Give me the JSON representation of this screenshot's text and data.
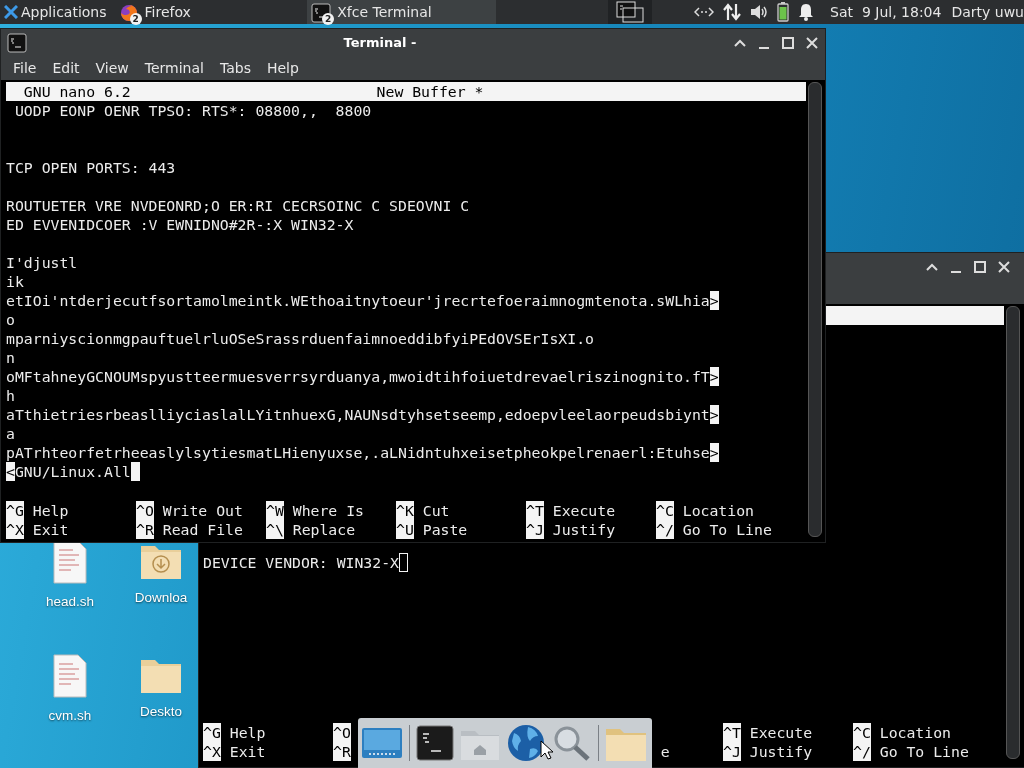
{
  "top_panel": {
    "menu_label": "Applications",
    "tasks": [
      {
        "label": "Firefox",
        "badge": "2",
        "kind": "browser",
        "selected": false
      },
      {
        "label": "Xfce Terminal",
        "badge": "2",
        "kind": "terminal",
        "selected": true
      }
    ],
    "clock": "Sat  9 Jul, 18:04",
    "user": "Darty uwu"
  },
  "desktop_icons": [
    {
      "label": "head.sh",
      "kind": "file"
    },
    {
      "label": "Downloa",
      "kind": "downloads"
    },
    {
      "label": "cvm.sh",
      "kind": "file"
    },
    {
      "label": "Deskto",
      "kind": "folder"
    }
  ],
  "main_window": {
    "title": "Terminal -",
    "menu": [
      "File",
      "Edit",
      "View",
      "Terminal",
      "Tabs",
      "Help"
    ],
    "nano": {
      "header_left": "GNU nano 6.2",
      "header_center": "New Buffer *",
      "lines": [
        {
          "kind": "text",
          "text": " UODP EONP OENR TPSO: RTS*: 08800,,  8800"
        },
        {
          "kind": "blank"
        },
        {
          "kind": "blank"
        },
        {
          "kind": "text",
          "text": "TCP OPEN PORTS: 443"
        },
        {
          "kind": "blank"
        },
        {
          "kind": "text",
          "text": "ROUTUETER VRE NVDEONRD;O ER:RI CECRSOINC C SDEOVNI C"
        },
        {
          "kind": "text",
          "text": "ED EVVENIDCOER :V EWNIDNO#2R-:X WIN32-X"
        },
        {
          "kind": "blank"
        },
        {
          "kind": "text",
          "text": "I'djustl"
        },
        {
          "kind": "text",
          "text": "ik"
        },
        {
          "kind": "text",
          "text": "etIOi'ntderjecutfsortamolmeintk.WEthoaitnytoeur'jrecrtefoeraimnogmtenota.sWLhia",
          "end_mark": ">"
        },
        {
          "kind": "text",
          "text": "o"
        },
        {
          "kind": "text",
          "text": "mparniyscionmgpauftuelrluOSeSrassrduenfaimnoeddibfyiPEdOVSErIsXI.o"
        },
        {
          "kind": "text",
          "text": "n"
        },
        {
          "kind": "text",
          "text": "oMFtahneyGCNOUMspyustteermuesverrsyrduanya,mwoidtihfoiuetdrevaelriszinognito.fT",
          "end_mark": ">"
        },
        {
          "kind": "text",
          "text": "h"
        },
        {
          "kind": "text",
          "text": "aTthietriesrbeaslliyciaslalLYitnhuexG,NAUNsdtyhsetseemp,edoepvleelaorpeudsbiynt",
          "end_mark": ">"
        },
        {
          "kind": "text",
          "text": "a"
        },
        {
          "kind": "text",
          "text": "pATrhteorfetrheeaslylsytiesmatLHienyuxse,.aLNidntuhxeisetpheokpelrenaerl:Etuhse",
          "end_mark": ">"
        },
        {
          "kind": "text",
          "lead_mark": "<",
          "text": "GNU/Linux.All",
          "cursor": true
        }
      ],
      "shortcuts": [
        {
          "kind": "full",
          "key": "^G",
          "label": "Help"
        },
        {
          "kind": "full",
          "key": "^O",
          "label": "Write Out"
        },
        {
          "kind": "full",
          "key": "^W",
          "label": "Where Is"
        },
        {
          "kind": "full",
          "key": "^K",
          "label": "Cut"
        },
        {
          "kind": "full",
          "key": "^T",
          "label": "Execute"
        },
        {
          "kind": "full",
          "key": "^C",
          "label": "Location"
        },
        {
          "kind": "full",
          "key": "^X",
          "label": "Exit"
        },
        {
          "kind": "full",
          "key": "^R",
          "label": "Read File"
        },
        {
          "kind": "full",
          "key": "^\\",
          "label": "Replace"
        },
        {
          "kind": "full",
          "key": "^U",
          "label": "Paste"
        },
        {
          "kind": "full",
          "key": "^J",
          "label": "Justify"
        },
        {
          "kind": "full",
          "key": "^/",
          "label": "Go To Line"
        }
      ]
    }
  },
  "back_window": {
    "nano": {
      "lines": [
        {
          "kind": "blank"
        },
        {
          "kind": "blank"
        },
        {
          "kind": "blank"
        },
        {
          "kind": "blank"
        },
        {
          "kind": "blank"
        },
        {
          "kind": "blank"
        },
        {
          "kind": "blank"
        },
        {
          "kind": "blank"
        },
        {
          "kind": "blank"
        },
        {
          "kind": "blank"
        },
        {
          "kind": "blank"
        },
        {
          "kind": "blank"
        },
        {
          "kind": "text",
          "text": "DEVICE VENDOR: WIN32-X",
          "cursor": true
        }
      ],
      "shortcuts": [
        {
          "kind": "full",
          "key": "^G",
          "label": "Help"
        },
        {
          "kind": "key",
          "key": "^O"
        },
        {
          "kind": "none"
        },
        {
          "kind": "none"
        },
        {
          "kind": "full",
          "key": "^T",
          "label": "Execute"
        },
        {
          "kind": "full",
          "key": "^C",
          "label": "Location"
        },
        {
          "kind": "full",
          "key": "^X",
          "label": "Exit"
        },
        {
          "kind": "key",
          "key": "^R"
        },
        {
          "kind": "none"
        },
        {
          "kind": "tail",
          "label": "e"
        },
        {
          "kind": "full",
          "key": "^J",
          "label": "Justify"
        },
        {
          "kind": "full",
          "key": "^/",
          "label": "Go To Line"
        }
      ]
    }
  },
  "dock": [
    {
      "kind": "desktop"
    },
    {
      "kind": "separator"
    },
    {
      "kind": "terminal"
    },
    {
      "kind": "home"
    },
    {
      "kind": "globe"
    },
    {
      "kind": "search"
    },
    {
      "kind": "separator"
    },
    {
      "kind": "folder"
    }
  ]
}
